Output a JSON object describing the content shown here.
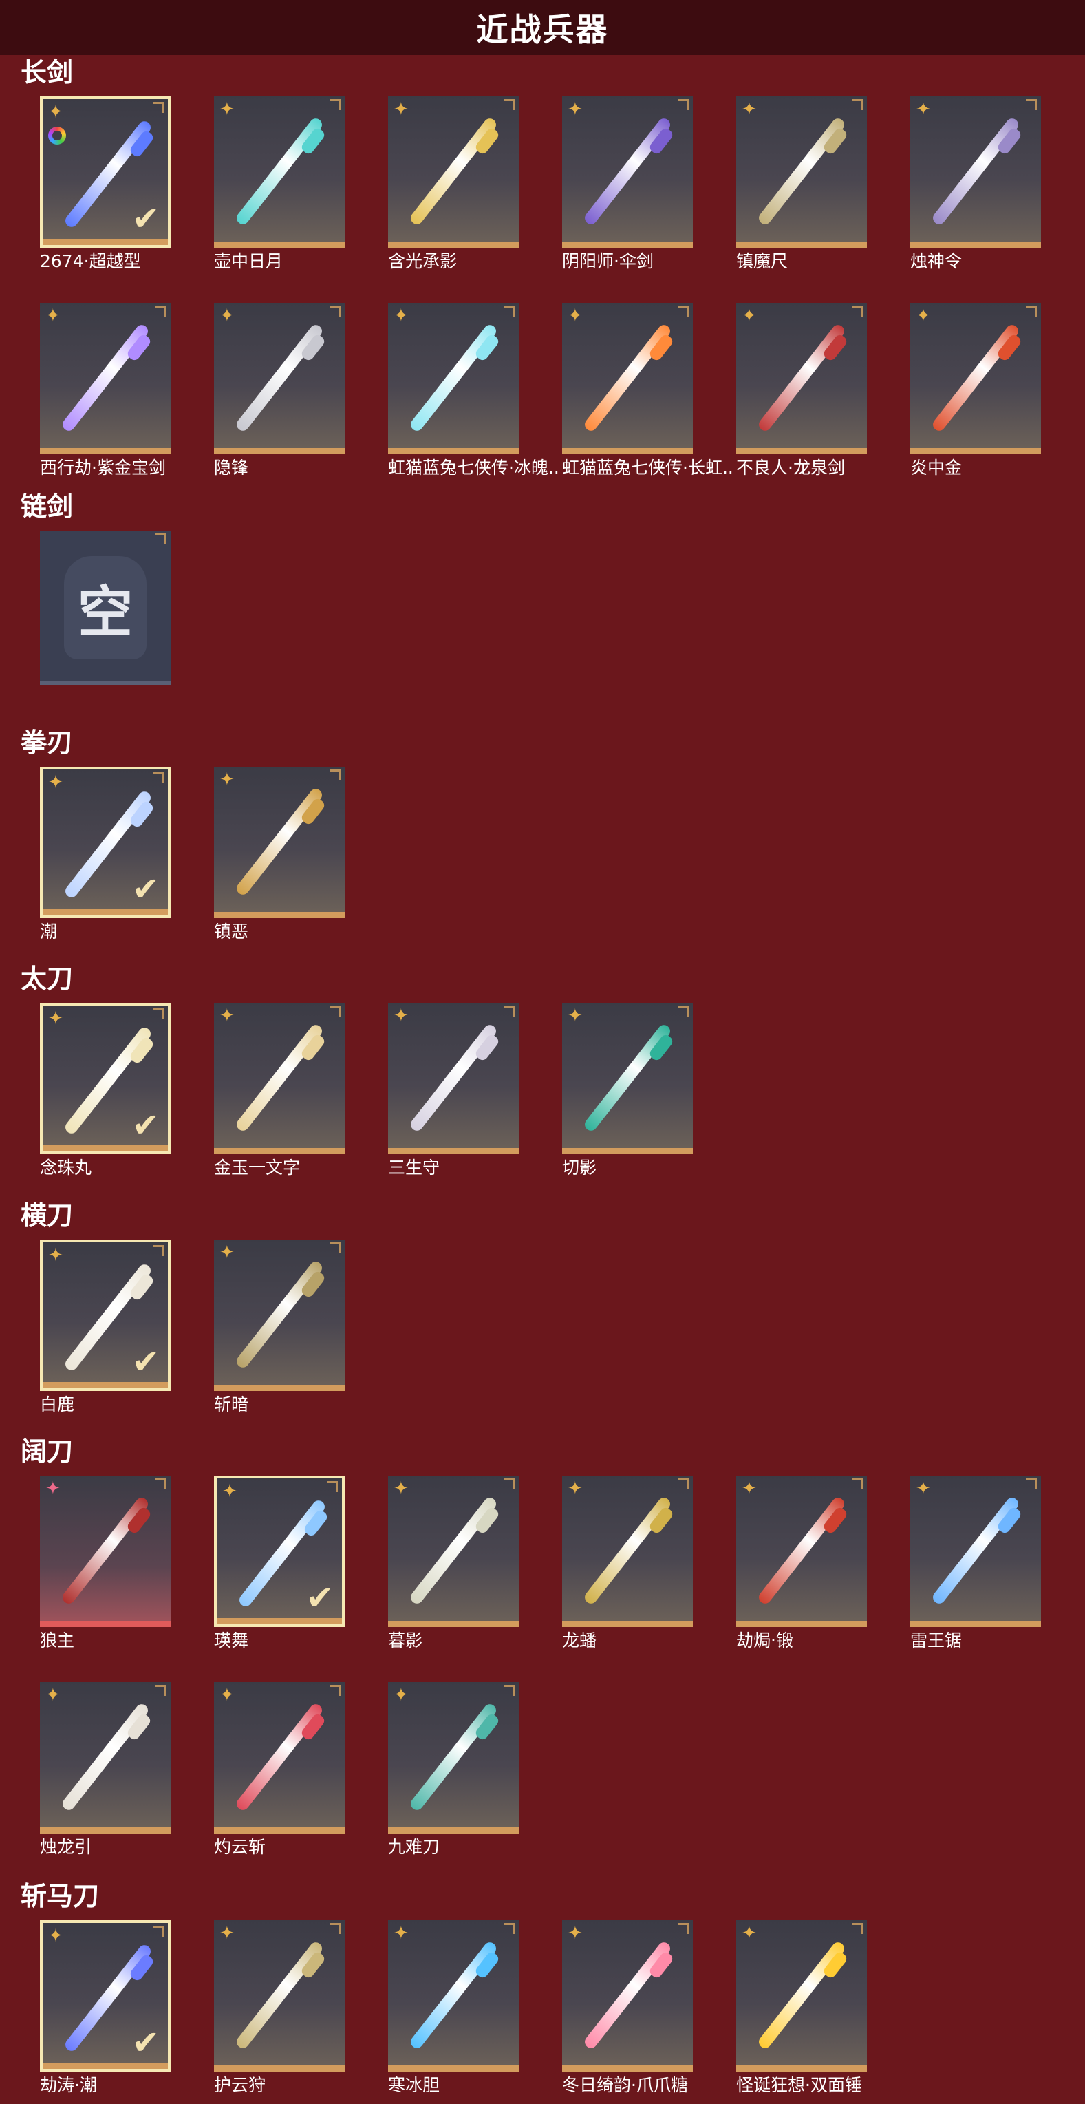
{
  "header": {
    "title": "近战兵器"
  },
  "categories": [
    {
      "label": "长剑",
      "items": [
        {
          "name": "2674·超越型",
          "selected": true,
          "badge": "ring",
          "color": "#5d7bff"
        },
        {
          "name": "壶中日月",
          "color": "#56d4d0"
        },
        {
          "name": "含光承影",
          "color": "#e5c256"
        },
        {
          "name": "阴阳师·伞剑",
          "color": "#7b5fd0"
        },
        {
          "name": "镇魔尺",
          "color": "#c2b07a"
        },
        {
          "name": "烛神令",
          "color": "#9a8ac9"
        },
        {
          "name": "西行劫·紫金宝剑",
          "color": "#b08cff"
        },
        {
          "name": "隐锋",
          "color": "#c8c8d0"
        },
        {
          "name": "虹猫蓝兔七侠传·冰魄...",
          "color": "#8fe6f2"
        },
        {
          "name": "虹猫蓝兔七侠传·长虹...",
          "color": "#ff8a3a"
        },
        {
          "name": "不良人·龙泉剑",
          "color": "#c23a3a"
        },
        {
          "name": "炎中金",
          "color": "#e0502e"
        }
      ]
    },
    {
      "label": "链剑",
      "items": [
        {
          "name": "",
          "empty": true,
          "empty_text": "空"
        }
      ]
    },
    {
      "label": "拳刃",
      "items": [
        {
          "name": "潮",
          "selected": true,
          "color": "#bcd3ff"
        },
        {
          "name": "镇恶",
          "color": "#d2a24a"
        }
      ]
    },
    {
      "label": "太刀",
      "items": [
        {
          "name": "念珠丸",
          "selected": true,
          "color": "#f0e4b8"
        },
        {
          "name": "金玉一文字",
          "color": "#e8d29a"
        },
        {
          "name": "三生守",
          "color": "#d6d0e0"
        },
        {
          "name": "切影",
          "color": "#2fb39a"
        }
      ]
    },
    {
      "label": "横刀",
      "items": [
        {
          "name": "白鹿",
          "selected": true,
          "color": "#ece6d8"
        },
        {
          "name": "斩暗",
          "color": "#b7a268"
        }
      ]
    },
    {
      "label": "阔刀",
      "items": [
        {
          "name": "狼主",
          "pink": true,
          "color": "#b0302e"
        },
        {
          "name": "瑛舞",
          "selected": true,
          "color": "#8ec8ff"
        },
        {
          "name": "暮影",
          "color": "#d7d7c2"
        },
        {
          "name": "龙蟠",
          "color": "#d1b14a"
        },
        {
          "name": "劫焗·锻",
          "color": "#d0402f"
        },
        {
          "name": "雷王锯",
          "color": "#6fb6ff"
        },
        {
          "name": "烛龙引",
          "color": "#e6e0d6"
        },
        {
          "name": "灼云斩",
          "color": "#e04a5a"
        },
        {
          "name": "九难刀",
          "color": "#4fb7a9"
        }
      ]
    },
    {
      "label": "斩马刀",
      "items": [
        {
          "name": "劫涛·潮",
          "selected": true,
          "color": "#6b7cff"
        },
        {
          "name": "护云狩",
          "color": "#cbb77a"
        },
        {
          "name": "寒冰胆",
          "color": "#55c2ff"
        },
        {
          "name": "冬日绮韵·爪爪糖",
          "color": "#ff8aa8"
        },
        {
          "name": "怪诞狂想·双面锤",
          "color": "#ffcc33"
        }
      ]
    }
  ],
  "icons": {
    "quality_star": "✦",
    "check": "✔",
    "corner": "corner-bracket-icon"
  }
}
